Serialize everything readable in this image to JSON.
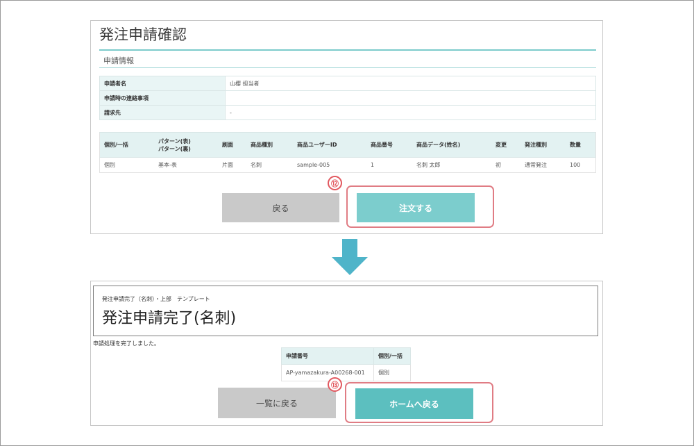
{
  "confirm": {
    "title": "発注申請確認",
    "section": "申請情報",
    "info": [
      {
        "label": "申請者名",
        "value": "山櫻 担当者"
      },
      {
        "label": "申請時の連絡事項",
        "value": ""
      },
      {
        "label": "請求先",
        "value": "-"
      }
    ],
    "order_headers": [
      "個別/一括",
      "パターン(表)\nパターン(裏)",
      "刷面",
      "商品種別",
      "商品ユーザーID",
      "商品番号",
      "商品データ(姓名)",
      "変更",
      "発注種別",
      "数量"
    ],
    "order_row": [
      "個別",
      "基本-表",
      "片面",
      "名刺",
      "sample-005",
      "1",
      "名刺 太郎",
      "初",
      "通常発注",
      "100"
    ],
    "back_label": "戻る",
    "order_label": "注文する",
    "step_label": "⑫"
  },
  "complete": {
    "crumb": "発注申請完了（名刺）・上部　テンプレート",
    "title": "発注申請完了(名刺)",
    "message": "申請処理を完了しました。",
    "headers": [
      "申請番号",
      "個別/一括"
    ],
    "row": [
      "AP-yamazakura-A00268-001",
      "個別"
    ],
    "list_back_label": "一覧に戻る",
    "home_label": "ホームへ戻る",
    "step_label": "⑬"
  },
  "colors": {
    "accent": "#7ccdcd",
    "highlight": "#e07c84",
    "arrow": "#4fb4c9"
  },
  "icons": {
    "flow_arrow": "down-arrow-icon"
  }
}
